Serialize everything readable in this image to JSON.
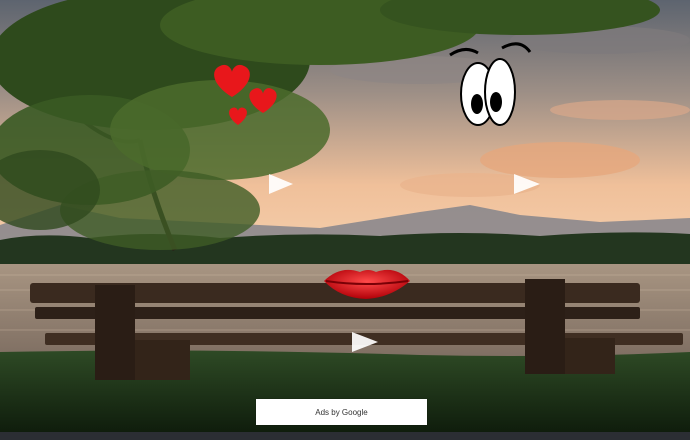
{
  "scene": {
    "description_icons": [
      "hearts-icon",
      "googly-eyes-icon",
      "red-lips-icon",
      "play-arrow-icon"
    ],
    "colors": {
      "sky_top": "#6e7480",
      "sky_glow": "#f2b98a",
      "water": "#9a8878",
      "grass": "#1f3a1c",
      "heart": "#e8171b",
      "lips": "#d4111a"
    }
  },
  "ad": {
    "label": "Ads by Google"
  }
}
